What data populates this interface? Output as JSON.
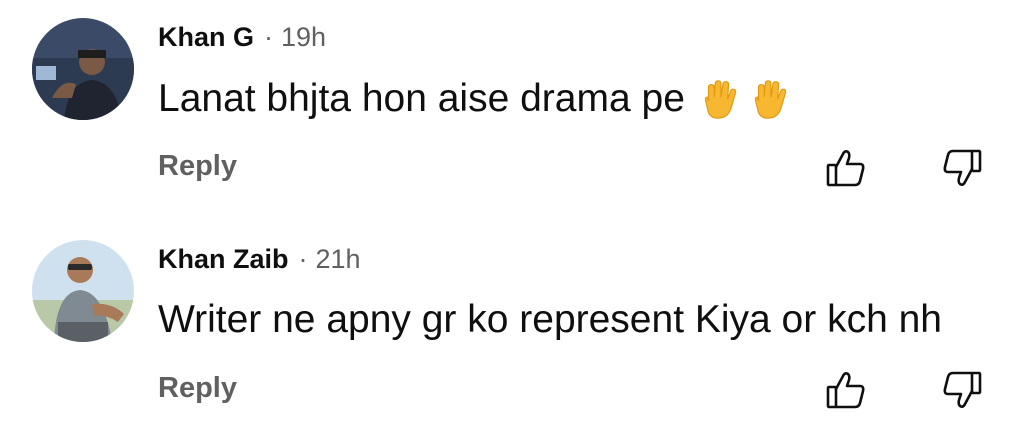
{
  "comments": [
    {
      "author": "Khan G",
      "separator": "·",
      "time": "19h",
      "text": "Lanat bhjta hon aise drama pe",
      "emoji_icons": [
        "raised-hand-emoji",
        "raised-hand-emoji"
      ],
      "reply_label": "Reply"
    },
    {
      "author": "Khan Zaib",
      "separator": "·",
      "time": "21h",
      "text": "Writer ne apny gr ko represent Kiya or kch nh",
      "emoji_icons": [],
      "reply_label": "Reply"
    }
  ],
  "icons": {
    "like": "thumbs-up-icon",
    "dislike": "thumbs-down-icon"
  },
  "colors": {
    "text": "#0f0f0f",
    "secondary": "#606060",
    "emoji": "#f7b731"
  }
}
